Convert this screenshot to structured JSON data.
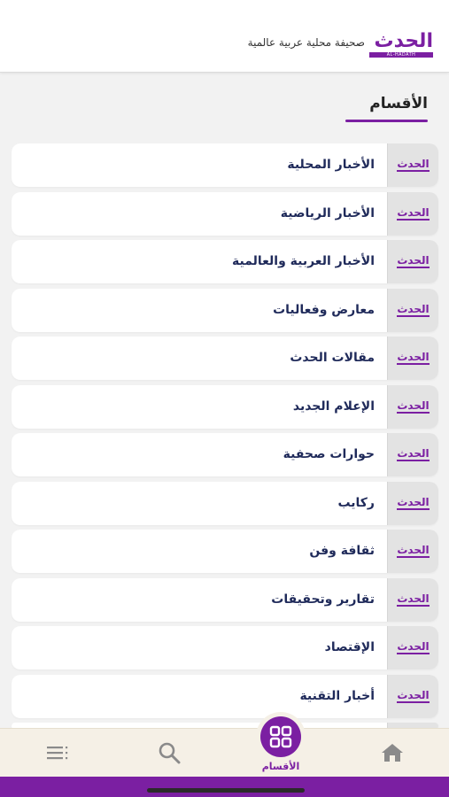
{
  "header": {
    "logo_ar": "الحدث",
    "logo_en": "AL-HADATH",
    "tagline": "صحيفة محلية عربية عالمية"
  },
  "section": {
    "title": "الأقسام"
  },
  "badge_text": "الحدث",
  "categories": [
    {
      "label": "الأخبار المحلية"
    },
    {
      "label": "الأخبار الرياضية"
    },
    {
      "label": "الأخبار العربية والعالمية"
    },
    {
      "label": "معارض وفعاليات"
    },
    {
      "label": "مقالات الحدث"
    },
    {
      "label": "الإعلام الجديد"
    },
    {
      "label": "حوارات صحفية"
    },
    {
      "label": "ركايب"
    },
    {
      "label": "ثقافة وفن"
    },
    {
      "label": "تقارير وتحقيقات"
    },
    {
      "label": "الإقتصاد"
    },
    {
      "label": "أخبار التقنية"
    }
  ],
  "nav": {
    "sections_label": "الأقسام",
    "icons": [
      "home-icon",
      "grid-icon",
      "search-icon",
      "menu-icon"
    ]
  },
  "colors": {
    "brand": "#7b1fa2",
    "label": "#1f2a5a",
    "nav_bg": "#f5f0e6"
  }
}
